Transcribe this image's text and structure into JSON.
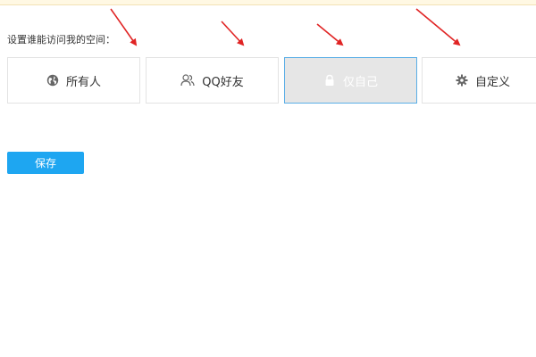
{
  "prompt": "设置谁能访问我的空间：",
  "options": [
    {
      "label": "所有人",
      "icon": "globe-icon",
      "selected": false
    },
    {
      "label": "QQ好友",
      "icon": "friends-icon",
      "selected": false
    },
    {
      "label": "仅自己",
      "icon": "lock-icon",
      "selected": true
    },
    {
      "label": "自定义",
      "icon": "gear-icon",
      "selected": false
    }
  ],
  "save_label": "保存",
  "colors": {
    "accent": "#1ea6f1",
    "selected_border": "#5aaee6",
    "selected_bg": "#e6e6e6",
    "annotation_arrow": "#e02424",
    "notice_bg": "#fff8e3"
  }
}
